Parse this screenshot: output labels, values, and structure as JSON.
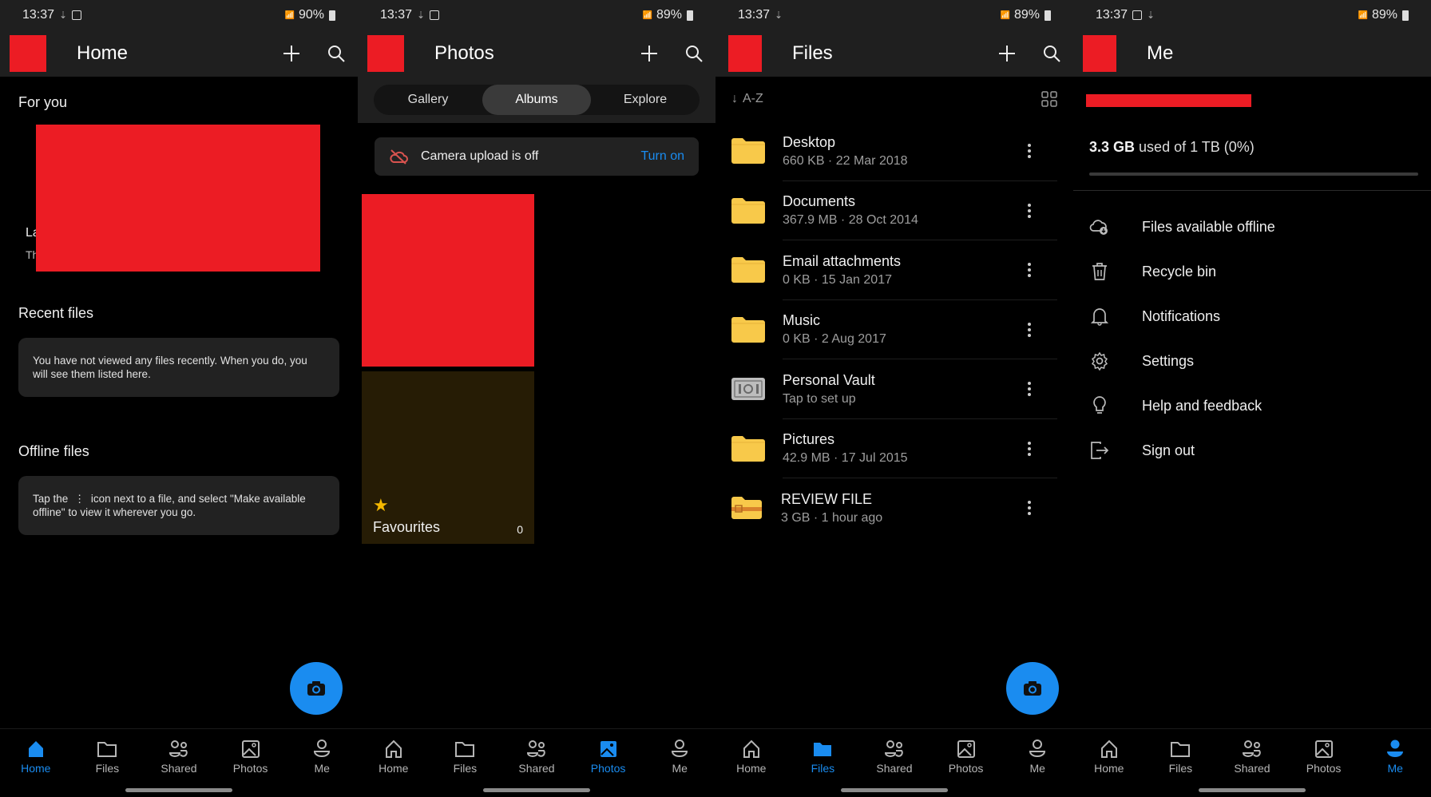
{
  "colors": {
    "accent": "#1a8cf0",
    "redacted": "#ec1c24",
    "folder": "#f8c94a",
    "header_bg": "#1f1f1f",
    "background": "#000000"
  },
  "screens": [
    {
      "status": {
        "time": "13:37",
        "battery": "90%"
      },
      "title": "Home",
      "for_you": {
        "heading": "For you",
        "peek_title": "La",
        "peek_sub": "Th"
      },
      "recent": {
        "heading": "Recent files",
        "message": "You have not viewed any files recently. When you do, you will see them listed here."
      },
      "offline": {
        "heading": "Offline files",
        "message_before": "Tap the",
        "message_after": "icon next to a file, and select \"Make available offline\" to view it wherever you go."
      },
      "active_tab": "Home"
    },
    {
      "status": {
        "time": "13:37",
        "battery": "89%"
      },
      "title": "Photos",
      "segments": [
        "Gallery",
        "Albums",
        "Explore"
      ],
      "active_segment": "Albums",
      "upload_banner": {
        "text": "Camera upload is off",
        "action": "Turn on"
      },
      "albums": [
        {
          "name": "",
          "redacted": true
        },
        {
          "name": "Favourites",
          "count": "0"
        }
      ],
      "active_tab": "Photos"
    },
    {
      "status": {
        "time": "13:37",
        "battery": "89%"
      },
      "title": "Files",
      "sort_label": "A-Z",
      "files": [
        {
          "name": "Desktop",
          "detail": "660 KB · 22 Mar 2018",
          "icon": "folder-icon"
        },
        {
          "name": "Documents",
          "detail": "367.9 MB · 28 Oct 2014",
          "icon": "folder-icon"
        },
        {
          "name": "Email attachments",
          "detail": "0 KB · 15 Jan 2017",
          "icon": "folder-icon"
        },
        {
          "name": "Music",
          "detail": "0 KB · 2 Aug 2017",
          "icon": "folder-icon"
        },
        {
          "name": "Personal Vault",
          "detail": "Tap to set up",
          "icon": "vault-icon"
        },
        {
          "name": "Pictures",
          "detail": "42.9 MB · 17 Jul 2015",
          "icon": "folder-icon"
        },
        {
          "name": "REVIEW FILE",
          "detail": "3 GB · 1 hour ago",
          "icon": "shared-folder-icon"
        }
      ],
      "active_tab": "Files"
    },
    {
      "status": {
        "time": "13:37",
        "battery": "89%"
      },
      "title": "Me",
      "storage": {
        "used": "3.3 GB",
        "rest": "used of 1 TB (0%)",
        "percent": 0
      },
      "menu": [
        {
          "label": "Files available offline",
          "icon": "cloud-offline-icon"
        },
        {
          "label": "Recycle bin",
          "icon": "trash-icon"
        },
        {
          "label": "Notifications",
          "icon": "bell-icon"
        },
        {
          "label": "Settings",
          "icon": "gear-icon"
        },
        {
          "label": "Help and feedback",
          "icon": "lightbulb-icon"
        },
        {
          "label": "Sign out",
          "icon": "sign-out-icon"
        }
      ],
      "active_tab": "Me"
    }
  ],
  "nav": [
    {
      "label": "Home",
      "icon": "home-icon"
    },
    {
      "label": "Files",
      "icon": "folder-icon"
    },
    {
      "label": "Shared",
      "icon": "shared-icon"
    },
    {
      "label": "Photos",
      "icon": "photo-icon"
    },
    {
      "label": "Me",
      "icon": "person-icon"
    }
  ]
}
